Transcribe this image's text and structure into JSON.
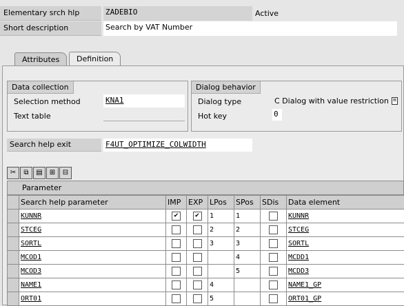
{
  "header": {
    "elem_label": "Elementary srch hlp",
    "elem_value": "ZADEBIO",
    "status": "Active",
    "short_desc_label": "Short description",
    "short_desc_value": "Search by VAT Number"
  },
  "tabs": [
    {
      "label": "Attributes",
      "active": false
    },
    {
      "label": "Definition",
      "active": true
    }
  ],
  "data_collection": {
    "title": "Data collection",
    "selection_method_label": "Selection method",
    "selection_method_value": "KNA1",
    "text_table_label": "Text table",
    "text_table_value": ""
  },
  "dialog_behavior": {
    "title": "Dialog behavior",
    "dialog_type_label": "Dialog type",
    "dialog_type_value": "C Dialog with value restriction",
    "hot_key_label": "Hot key",
    "hot_key_value": "0"
  },
  "search_help_exit": {
    "label": "Search help exit",
    "value": "F4UT_OPTIMIZE_COLWIDTH"
  },
  "toolbar": {
    "icons": [
      "cut-icon",
      "copy-icon",
      "paste-icon",
      "insert-row-icon",
      "delete-row-icon"
    ]
  },
  "table": {
    "title": "Parameter",
    "columns": [
      "Search help parameter",
      "IMP",
      "EXP",
      "LPos",
      "SPos",
      "SDis",
      "Data element"
    ],
    "rows": [
      {
        "param": "KUNNR",
        "imp": true,
        "exp": true,
        "lpos": "1",
        "spos": "1",
        "sdis": false,
        "elem": "KUNNR"
      },
      {
        "param": "STCEG",
        "imp": false,
        "exp": false,
        "lpos": "2",
        "spos": "2",
        "sdis": false,
        "elem": "STCEG"
      },
      {
        "param": "SORTL",
        "imp": false,
        "exp": false,
        "lpos": "3",
        "spos": "3",
        "sdis": false,
        "elem": "SORTL"
      },
      {
        "param": "MCOD1",
        "imp": false,
        "exp": false,
        "lpos": "",
        "spos": "4",
        "sdis": false,
        "elem": "MCDD1"
      },
      {
        "param": "MCOD3",
        "imp": false,
        "exp": false,
        "lpos": "",
        "spos": "5",
        "sdis": false,
        "elem": "MCDD3"
      },
      {
        "param": "NAME1",
        "imp": false,
        "exp": false,
        "lpos": "4",
        "spos": "",
        "sdis": false,
        "elem": "NAME1_GP"
      },
      {
        "param": "ORT01",
        "imp": false,
        "exp": false,
        "lpos": "5",
        "spos": "",
        "sdis": false,
        "elem": "ORT01_GP"
      }
    ]
  }
}
